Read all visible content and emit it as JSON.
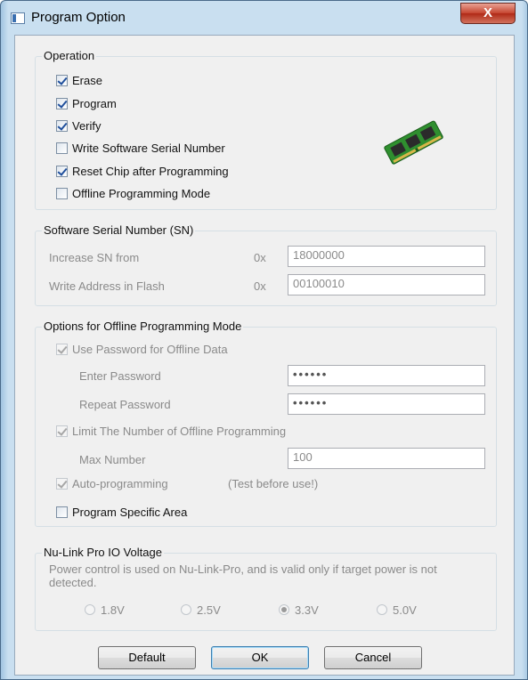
{
  "window": {
    "title": "Program Option",
    "close_glyph": "X"
  },
  "operation": {
    "legend": "Operation",
    "items": [
      {
        "label": "Erase",
        "checked": true
      },
      {
        "label": "Program",
        "checked": true
      },
      {
        "label": "Verify",
        "checked": true
      },
      {
        "label": "Write Software Serial Number",
        "checked": false
      },
      {
        "label": "Reset Chip after Programming",
        "checked": true
      },
      {
        "label": "Offline Programming Mode",
        "checked": false
      }
    ],
    "icon": "memory-module-icon"
  },
  "serial": {
    "legend": "Software Serial Number (SN)",
    "increase_label": "Increase SN from",
    "increase_prefix": "0x",
    "increase_value": "18000000",
    "address_label": "Write Address in Flash",
    "address_prefix": "0x",
    "address_value": "00100010"
  },
  "offline": {
    "legend": "Options for Offline Programming Mode",
    "use_password_label": "Use Password for Offline Data",
    "enter_password_label": "Enter Password",
    "enter_password_value": "••••••",
    "repeat_password_label": "Repeat Password",
    "repeat_password_value": "••••••",
    "limit_label": "Limit The Number of Offline Programming",
    "max_label": "Max Number",
    "max_value": "100",
    "auto_label": "Auto-programming",
    "auto_note": "(Test before use!)",
    "specific_area_label": "Program Specific Area"
  },
  "voltage": {
    "legend": "Nu-Link Pro IO Voltage",
    "note": "Power control is used on Nu-Link-Pro, and is valid only if target power is not detected.",
    "options": [
      "1.8V",
      "2.5V",
      "3.3V",
      "5.0V"
    ],
    "selected": "3.3V"
  },
  "buttons": {
    "default": "Default",
    "ok": "OK",
    "cancel": "Cancel"
  },
  "colors": {
    "accent": "#1f4f9c",
    "close": "#c5442f",
    "disabled_text": "#8a8a8a"
  }
}
